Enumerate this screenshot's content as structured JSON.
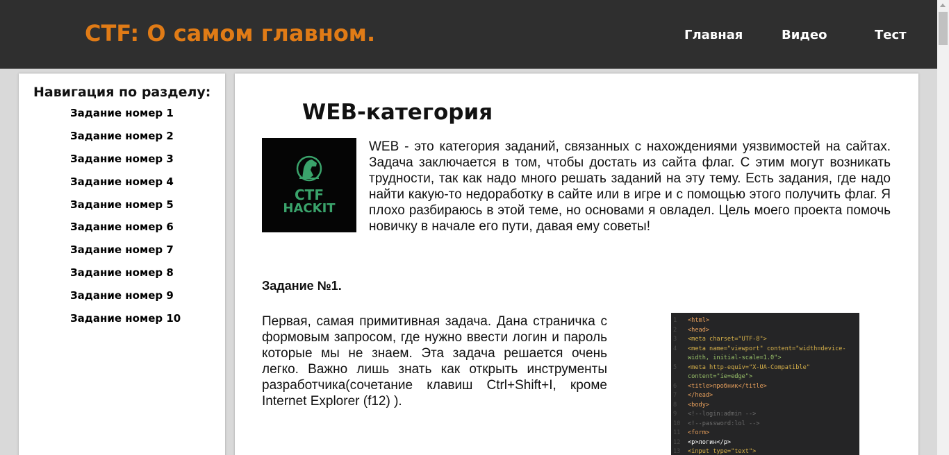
{
  "header": {
    "site_title": "CTF: О самом главном.",
    "nav": [
      {
        "label": "Главная"
      },
      {
        "label": "Видео"
      },
      {
        "label": "Тест"
      }
    ]
  },
  "sidebar": {
    "title": "Навигация по разделу:",
    "items": [
      {
        "label": "Задание номер 1"
      },
      {
        "label": "Задание номер 2"
      },
      {
        "label": "Задание номер 3"
      },
      {
        "label": "Задание номер 4"
      },
      {
        "label": "Задание номер 5"
      },
      {
        "label": "Задание номер 6"
      },
      {
        "label": "Задание номер 7"
      },
      {
        "label": "Задание номер 8"
      },
      {
        "label": "Задание номер 9"
      },
      {
        "label": "Задание номер 10"
      }
    ]
  },
  "main": {
    "title": "WEB-категория",
    "logo": {
      "line1": "CTF",
      "line2": "HACKIT"
    },
    "intro": "WEB - это категория заданий, связанных с нахождениями уязвимостей на сайтах. Задача заключается в том, чтобы достать из сайта флаг. С этим могут возникать трудности, так как надо много решать заданий на эту тему. Есть задания, где надо найти какую-то недоработку в сайте или в игре и с помощью этого получить флаг. Я плохо разбираюсь в этой теме, но основами я овладел. Цель моего проекта помочь новичку в начале его пути, давая ему советы!",
    "task1": {
      "heading": "Задание №1.",
      "text": "Первая, самая примитивная задача. Дана страничка с формовым запросом, где нужно ввести логин и пароль которые мы не знаем. Эта задача решается очень легко. Важно лишь знать как открыть инструменты разработчика(сочетание клавиш Ctrl+Shift+I, кроме Internet Explorer (f12) )."
    },
    "code_lines": [
      {
        "n": "1",
        "text": "<html>"
      },
      {
        "n": "2",
        "text": "<head>"
      },
      {
        "n": "3",
        "text": "    <meta charset=\"UTF-8\">"
      },
      {
        "n": "4",
        "text": "    <meta name=\"viewport\" content=\"width=device-"
      },
      {
        "n": "",
        "text": "width, initial-scale=1.0\">"
      },
      {
        "n": "5",
        "text": "    <meta http-equiv=\"X-UA-Compatible\""
      },
      {
        "n": "",
        "text": "content=\"ie=edge\">"
      },
      {
        "n": "6",
        "text": "    <title>пробник</title>"
      },
      {
        "n": "7",
        "text": "</head>"
      },
      {
        "n": "8",
        "text": "<body>"
      },
      {
        "n": "9",
        "text": "<!--login:admin -->"
      },
      {
        "n": "10",
        "text": "<!--password:lol -->"
      },
      {
        "n": "11",
        "text": "<form>"
      },
      {
        "n": "12",
        "text": "<p>логин</p>"
      },
      {
        "n": "13",
        "text": "    <input type=\"text\">"
      }
    ]
  },
  "colors": {
    "header_bg": "#2f2f2f",
    "title_orange": "#e07b16",
    "page_bg": "#d9d9d9",
    "logo_green": "#3aa36b",
    "code_bg": "#252526"
  }
}
